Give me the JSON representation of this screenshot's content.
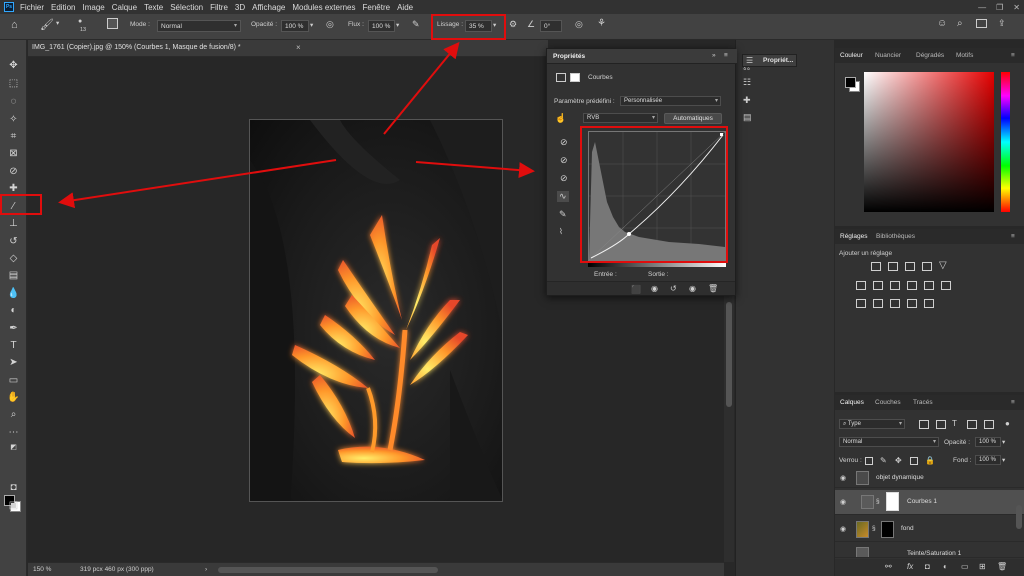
{
  "app": {
    "logo": "Ps"
  },
  "menu": {
    "items": [
      "Fichier",
      "Edition",
      "Image",
      "Calque",
      "Texte",
      "Sélection",
      "Filtre",
      "3D",
      "Affichage",
      "Modules externes",
      "Fenêtre",
      "Aide"
    ],
    "window_controls": [
      "—",
      "❐",
      "✕"
    ]
  },
  "options_bar": {
    "home_icon": "home-icon",
    "brush_size": "13",
    "mode_label": "Mode :",
    "mode_value": "Normal",
    "opacity_label": "Opacité :",
    "opacity_value": "100 %",
    "flux_label": "Flux :",
    "flux_value": "100 %",
    "lissage_label": "Lissage :",
    "lissage_value": "35 %",
    "angle_value": "0°"
  },
  "document": {
    "tab_title": "IMG_1761 (Copier).jpg @ 150% (Courbes 1, Masque de fusion/8) *",
    "close": "×"
  },
  "status_bar": {
    "zoom": "150 %",
    "doc_info": "319 pcx 460 px (300 ppp)"
  },
  "properties_panel": {
    "title": "Propriétés",
    "section": "Courbes",
    "preset_label": "Paramètre prédéfini :",
    "preset_value": "Personnalisée",
    "channel": "RVB",
    "auto_button": "Automatiques",
    "entree_label": "Entrée :",
    "sortie_label": "Sortie :"
  },
  "dock": {
    "properties_button": "Propriét..."
  },
  "color_panel": {
    "tabs": [
      "Couleur",
      "Nuancier",
      "Dégradés",
      "Motifs"
    ]
  },
  "adjustments_panel": {
    "tabs": [
      "Réglages",
      "Bibliothèques"
    ],
    "hint": "Ajouter un réglage"
  },
  "layers_panel": {
    "tabs": [
      "Calques",
      "Couches",
      "Tracés"
    ],
    "filter_value": "Type",
    "blend_mode": "Normal",
    "opacity_label": "Opacité :",
    "opacity_value": "100 %",
    "lock_label": "Verrou :",
    "fill_label": "Fond :",
    "fill_value": "100 %",
    "layers": [
      {
        "name": "objet dynamique"
      },
      {
        "name": "Courbes 1"
      },
      {
        "name": "fond"
      },
      {
        "name": "Teinte/Saturation 1"
      }
    ]
  },
  "colors": {
    "annotation_red": "#e00d0d",
    "panel_bg": "#323232",
    "selected_layer": "#505050"
  }
}
